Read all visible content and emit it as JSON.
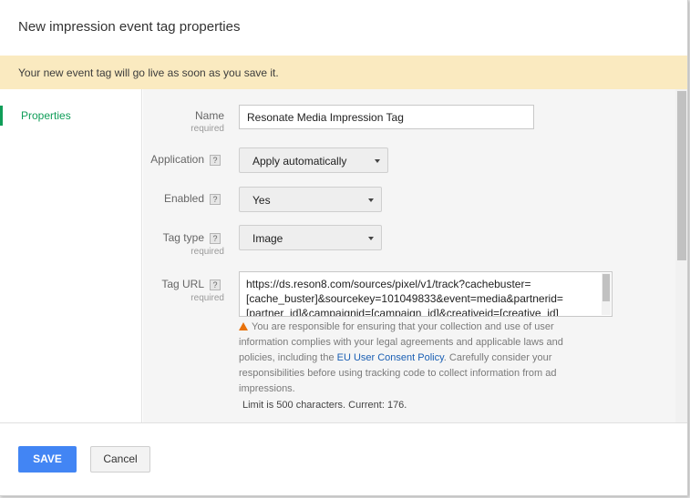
{
  "dialog": {
    "title": "New impression event tag properties"
  },
  "banner": {
    "text": "Your new event tag will go live as soon as you save it."
  },
  "sidebar": {
    "items": [
      {
        "label": "Properties",
        "active": true
      }
    ]
  },
  "form": {
    "name": {
      "label": "Name",
      "required": "required",
      "value": "Resonate Media Impression Tag"
    },
    "application": {
      "label": "Application",
      "help": "?",
      "value": "Apply automatically"
    },
    "enabled": {
      "label": "Enabled",
      "help": "?",
      "value": "Yes"
    },
    "tag_type": {
      "label": "Tag type",
      "help": "?",
      "required": "required",
      "value": "Image"
    },
    "tag_url": {
      "label": "Tag URL",
      "help": "?",
      "required": "required",
      "lines": [
        "https://ds.reson8.com/sources/pixel/v1/track?cachebuster=",
        "[cache_buster]&sourcekey=101049833&event=media&partnerid=",
        "[partner_id]&campaignid=[campaign_id]&creativeid=[creative_id]"
      ]
    },
    "warning": {
      "before_link": "You are responsible for ensuring that your collection and use of user information complies with your legal agreements and applicable laws and policies, including the ",
      "link": "EU User Consent Policy",
      "after_link": ". Carefully consider your responsibilities before using tracking code to collect information from ad impressions."
    },
    "limit_text": "Limit is 500 characters. Current: 176."
  },
  "footer": {
    "save_label": "SAVE",
    "cancel_label": "Cancel"
  },
  "colors": {
    "accent": "#4285f4",
    "active_nav": "#0f9d58",
    "banner_bg": "#faeac0",
    "warning_icon": "#e8710a",
    "link": "#1a5fb4"
  },
  "icons": {
    "help": "help-icon",
    "caret": "chevron-down-icon",
    "warning": "warning-icon"
  }
}
